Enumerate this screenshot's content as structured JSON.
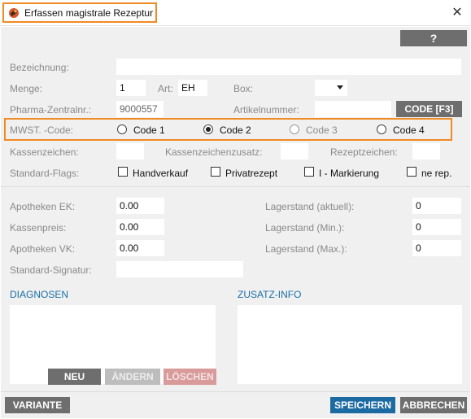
{
  "window": {
    "title": "Erfassen magistrale Rezeptur",
    "close_glyph": "✕",
    "help_label": "?"
  },
  "form": {
    "bezeichnung": {
      "label": "Bezeichnung:",
      "value": ""
    },
    "menge": {
      "label": "Menge:",
      "value": "1"
    },
    "art": {
      "label": "Art:",
      "value": "EH"
    },
    "box": {
      "label": "Box:",
      "value": ""
    },
    "pzn": {
      "label": "Pharma-Zentralnr.:",
      "value": "9000557"
    },
    "artikelnummer": {
      "label": "Artikelnummer:",
      "value": ""
    },
    "code_button": "CODE [F3]",
    "mwst": {
      "label": "MWST. -Code:",
      "options": [
        {
          "label": "Code 1",
          "selected": false,
          "enabled": true
        },
        {
          "label": "Code 2",
          "selected": true,
          "enabled": true
        },
        {
          "label": "Code 3",
          "selected": false,
          "enabled": false
        },
        {
          "label": "Code 4",
          "selected": false,
          "enabled": true
        }
      ]
    },
    "kassenzeichen": {
      "label": "Kassenzeichen:",
      "value": ""
    },
    "kassenzeichenzusatz": {
      "label": "Kassenzeichenzusatz:",
      "value": ""
    },
    "rezeptzeichen": {
      "label": "Rezeptzeichen:",
      "value": ""
    },
    "flags": {
      "label": "Standard-Flags:",
      "items": [
        {
          "label": "Handverkauf",
          "checked": false
        },
        {
          "label": "Privatrezept",
          "checked": false
        },
        {
          "label": "I - Markierung",
          "checked": false
        },
        {
          "label": "ne rep.",
          "checked": false
        }
      ]
    },
    "apotheken_ek": {
      "label": "Apotheken EK:",
      "value": "0.00"
    },
    "kassenpreis": {
      "label": "Kassenpreis:",
      "value": "0.00"
    },
    "apotheken_vk": {
      "label": "Apotheken VK:",
      "value": "0.00"
    },
    "signatur": {
      "label": "Standard-Signatur:",
      "value": ""
    },
    "lager_aktuell": {
      "label": "Lagerstand (aktuell):",
      "value": "0"
    },
    "lager_min": {
      "label": "Lagerstand (Min.):",
      "value": "0"
    },
    "lager_max": {
      "label": "Lagerstand (Max.):",
      "value": "0"
    }
  },
  "diagnosen": {
    "title": "DIAGNOSEN",
    "buttons": {
      "neu": "NEU",
      "aendern": "ÄNDERN",
      "loeschen": "LÖSCHEN"
    }
  },
  "zusatz": {
    "title": "ZUSATZ-INFO"
  },
  "footer": {
    "variante": "VARIANTE",
    "speichern": "SPEICHERN",
    "abbrechen": "ABBRECHEN"
  },
  "colors": {
    "highlight": "#f08a24",
    "section": "#1a6fa8",
    "primary_button": "#1b6aa2",
    "neutral_button": "#6e6e6e"
  }
}
